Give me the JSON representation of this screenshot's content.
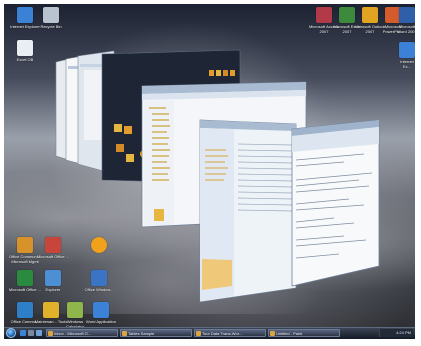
{
  "desktop": {
    "top_left_icons": [
      {
        "label": "Internet Explorer",
        "icon": "internet-explorer-icon",
        "color": "#3b82d6"
      },
      {
        "label": "Recycle Bin",
        "icon": "recycle-bin-icon",
        "color": "#b9c3cf"
      },
      {
        "label": "Excel OB",
        "icon": "document-icon",
        "color": "#e9eef4"
      }
    ],
    "top_right_icons": [
      {
        "label": "Microsoft Access 2007",
        "icon": "access-icon",
        "color": "#b23a48"
      },
      {
        "label": "Microsoft Excel 2007",
        "icon": "excel-icon",
        "color": "#3c8a3c"
      },
      {
        "label": "Microsoft Outlook 2007",
        "icon": "outlook-icon",
        "color": "#e0a422"
      },
      {
        "label": "Microsoft PowerPoi...",
        "icon": "powerpoint-icon",
        "color": "#d35b2c"
      },
      {
        "label": "Microsoft Word 2007",
        "icon": "word-icon",
        "color": "#2f5fa8"
      },
      {
        "label": "Internet Ex...",
        "icon": "internet-explorer-icon",
        "color": "#3b82d6"
      }
    ],
    "bottom_left_icons": [
      {
        "label": "Office Communi... Microsoft Mgmt",
        "icon": "communicator-icon",
        "color": "#d8922a"
      },
      {
        "label": "Microsoft Office ...",
        "icon": "office-icon",
        "color": "#c7453a"
      },
      {
        "label": "",
        "icon": "sun-icon",
        "color": "#f1a21a"
      },
      {
        "label": "Microsoft Office ...",
        "icon": "office-icon",
        "color": "#2a8a3f"
      },
      {
        "label": "Explorer",
        "icon": "explorer-icon",
        "color": "#4d8fd4"
      },
      {
        "label": "Office Window...",
        "icon": "window-icon",
        "color": "#3a74c4"
      },
      {
        "label": "Office Commu...",
        "icon": "communicator-icon",
        "color": "#2d7fc8"
      },
      {
        "label": "Maintenan... Tools",
        "icon": "tools-icon",
        "color": "#e0b22c"
      },
      {
        "label": "Windows Calculator",
        "icon": "calculator-icon",
        "color": "#8fb64a"
      },
      {
        "label": "Word Application",
        "icon": "internet-explorer-icon",
        "color": "#3b82d6"
      }
    ]
  },
  "flip3d": {
    "front_window_title": "RE: Meeting agenda - Message",
    "middle_window_title": "Inbox - Microsoft Outlook",
    "back_window_title": "Computer"
  },
  "taskbar": {
    "buttons": [
      {
        "label": "Inbox - Microsoft O..."
      },
      {
        "label": "Tables Sample"
      },
      {
        "label": "Tour Data Trans-Wor..."
      },
      {
        "label": "Untitled - Paint"
      }
    ],
    "clock": "4:24 PM"
  }
}
